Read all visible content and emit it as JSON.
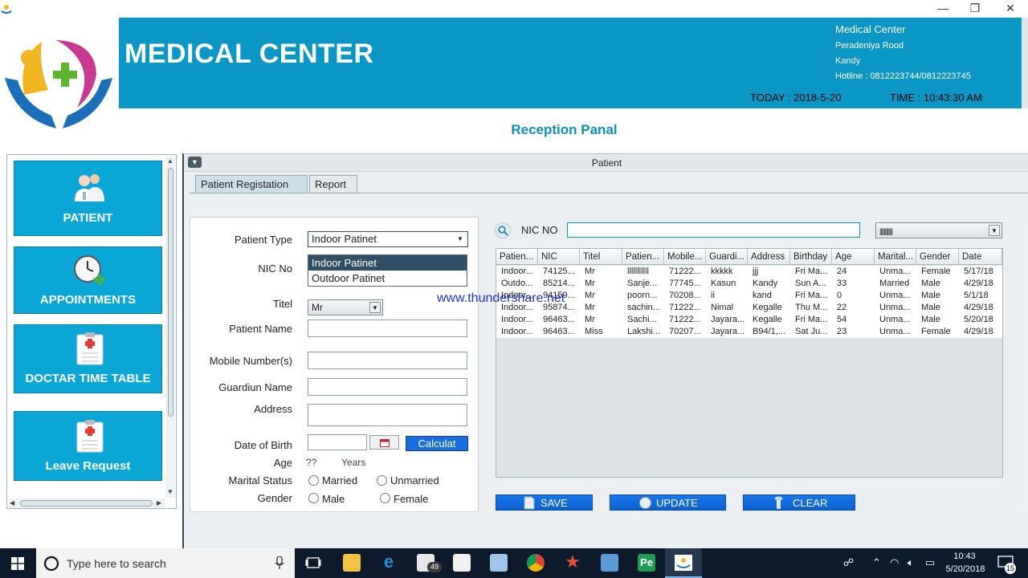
{
  "window": {
    "minimize": "—",
    "restore": "❐",
    "close": "✕"
  },
  "header": {
    "app_title": "MEDICAL CENTER",
    "center_name": "Medical Center",
    "address_line1": "Peradeniya Rood",
    "address_line2": "Kandy",
    "hotline": "Hotline : 0812223744/0812223745",
    "today": "TODAY :  2018-5-20",
    "time": "TIME : 10:43:30 AM",
    "brand_color": "#0a97c6"
  },
  "page_title": "Reception Panal",
  "nav": {
    "items": [
      {
        "label": "PATIENT",
        "icon": "doctors-icon"
      },
      {
        "label": "APPOINTMENTS",
        "icon": "clock-add-icon"
      },
      {
        "label": "DOCTAR TIME TABLE",
        "icon": "medical-clipboard-icon"
      },
      {
        "label": "Leave Request",
        "icon": "medical-clipboard-icon"
      }
    ]
  },
  "panel": {
    "title": "Patient",
    "tabs": [
      "Patient Registation",
      "Report"
    ]
  },
  "form": {
    "patient_type_label": "Patient Type",
    "patient_type_value": "Indoor Patinet",
    "dropdown_options": [
      "Indoor Patinet",
      "Outdoor Patinet"
    ],
    "nic_label": "NIC No",
    "title_label": "Titel",
    "title_value": "Mr",
    "name_label": "Patient Name",
    "mobile_label": "Mobile Number(s)",
    "guardian_label": "Guardiun Name",
    "address_label": "Address",
    "dob_label": "Date of Birth",
    "calculate_label": "Calculat",
    "age_label": "Age",
    "age_value": "??",
    "age_unit": "Years",
    "marital_label": "Marital Status",
    "marital_options": [
      "Married",
      "Unmarried"
    ],
    "gender_label": "Gender",
    "gender_options": [
      "Male",
      "Female"
    ]
  },
  "search": {
    "label": "NIC NO",
    "filter_value": "||||||||||||"
  },
  "table": {
    "columns": [
      "Patien...",
      "NIC",
      "Titel",
      "Patien...",
      "Mobile...",
      "Guardi...",
      "Address",
      "Birthday",
      "Age",
      "Marital...",
      "Gender",
      "Date"
    ],
    "rows": [
      [
        "Indoor...",
        "74125...",
        "Mr",
        "lllllllllll",
        "71222...",
        "kkkkk",
        "jjj",
        "Fri Ma...",
        "24",
        "Unma...",
        "Female",
        "5/17/18"
      ],
      [
        "Outdo...",
        "85214...",
        "Mr",
        "Sanje...",
        "77745...",
        "Kasun",
        "Kandy",
        "Sun A...",
        "33",
        "Married",
        "Male",
        "4/29/18"
      ],
      [
        "Indoor...",
        "94159...",
        "Mr",
        "poorn...",
        "70208...",
        "ii",
        "kand",
        "Fri Ma...",
        "0",
        "Unma...",
        "Male",
        "5/1/18"
      ],
      [
        "Indoor...",
        "95874...",
        "Mr",
        "sachin...",
        "71222...",
        "Nimal",
        "Kegalle",
        "Thu M...",
        "22",
        "Unma...",
        "Male",
        "4/29/18"
      ],
      [
        "Indoor...",
        "96463...",
        "Mr",
        "Sachi...",
        "71222...",
        "Jayara...",
        "Kegalle",
        "Fri Ma...",
        "54",
        "Unma...",
        "Male",
        "5/20/18"
      ],
      [
        "Indoor...",
        "96463...",
        "Miss",
        "Lakshi...",
        "70207...",
        "Jayara...",
        "B94/1,...",
        "Sat Ju...",
        "23",
        "Unma...",
        "Female",
        "4/29/18"
      ]
    ]
  },
  "actions": {
    "save": "SAVE",
    "update": "UPDATE",
    "clear": "CLEAR"
  },
  "watermark": "www.thundershare.net",
  "taskbar": {
    "search_placeholder": "Type here to search",
    "mail_badge": "49",
    "clock_time": "10:43",
    "clock_date": "5/20/2018",
    "notification_count": "15"
  }
}
